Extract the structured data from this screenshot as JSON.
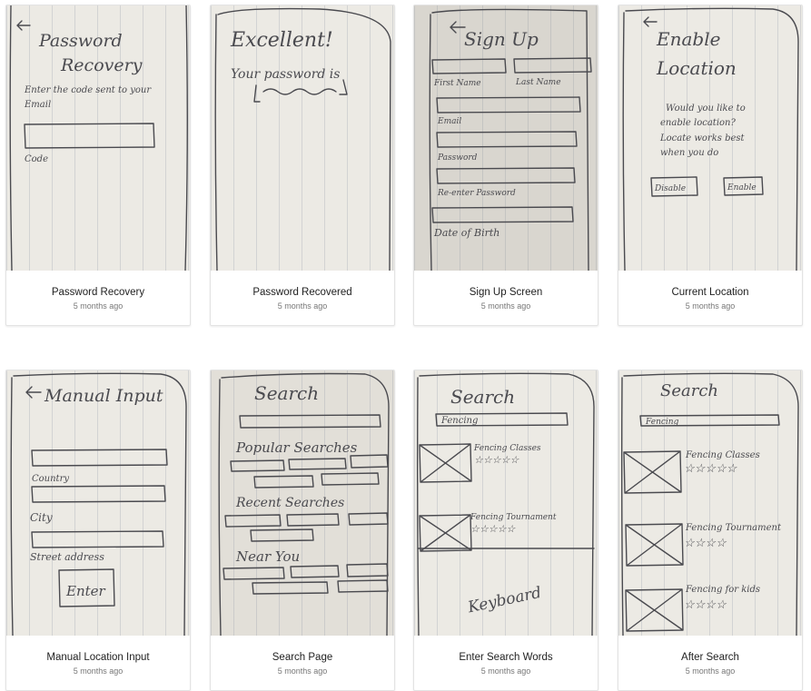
{
  "cards": [
    {
      "title": "Password Recovery",
      "time": "5 months ago",
      "sketch": {
        "heading1": "Password",
        "heading2": "Recovery",
        "line1": "Enter the code sent to your",
        "line2": "Email",
        "field": "Code"
      }
    },
    {
      "title": "Password Recovered",
      "time": "5 months ago",
      "sketch": {
        "heading": "Excellent!",
        "line1": "Your password is"
      }
    },
    {
      "title": "Sign Up Screen",
      "time": "5 months ago",
      "sketch": {
        "heading": "Sign Up",
        "first": "First Name",
        "last": "Last Name",
        "email": "Email",
        "password": "Password",
        "reenter": "Re-enter Password",
        "dob": "Date of Birth"
      }
    },
    {
      "title": "Current Location",
      "time": "5 months ago",
      "sketch": {
        "heading1": "Enable",
        "heading2": "Location",
        "line1": "Would you like to",
        "line2": "enable location?",
        "line3": "Locate works best",
        "line4": "when you do",
        "disable": "Disable",
        "enable": "Enable"
      }
    },
    {
      "title": "Manual Location Input",
      "time": "5 months ago",
      "sketch": {
        "heading": "Manual Input",
        "country": "Country",
        "city": "City",
        "street": "Street address",
        "enter": "Enter"
      }
    },
    {
      "title": "Search Page",
      "time": "5 months ago",
      "sketch": {
        "heading": "Search",
        "popular": "Popular Searches",
        "recent": "Recent Searches",
        "near": "Near You"
      }
    },
    {
      "title": "Enter Search Words",
      "time": "5 months ago",
      "sketch": {
        "heading": "Search",
        "query": "Fencing",
        "r1": "Fencing Classes",
        "r2": "Fencing Tournament",
        "keyboard": "Keyboard"
      }
    },
    {
      "title": "After Search",
      "time": "5 months ago",
      "sketch": {
        "heading": "Search",
        "query": "Fencing",
        "r1": "Fencing Classes",
        "r2": "Fencing Tournament",
        "r3": "Fencing for kids"
      }
    }
  ]
}
